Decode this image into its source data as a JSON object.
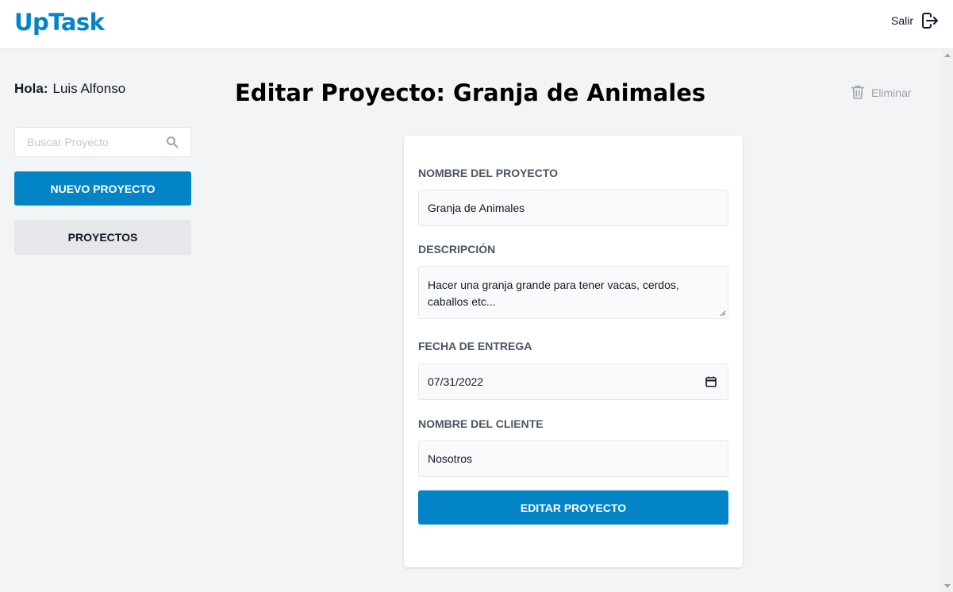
{
  "app": {
    "logo": "UpTask",
    "logout_label": "Salir",
    "brand_color": "#0284c7"
  },
  "sidebar": {
    "greeting_label": "Hola:",
    "user_name": "Luis Alfonso",
    "search_placeholder": "Buscar Proyecto",
    "search_value": "",
    "new_project_label": "NUEVO PROYECTO",
    "projects_label": "PROYECTOS"
  },
  "main": {
    "title": "Editar Proyecto: Granja de Animales",
    "delete_label": "Eliminar"
  },
  "form": {
    "name_label": "NOMBRE DEL PROYECTO",
    "name_value": "Granja de Animales",
    "description_label": "DESCRIPCIÓN",
    "description_value": "Hacer una granja grande para tener vacas, cerdos, caballos etc...",
    "due_date_label": "FECHA DE ENTREGA",
    "due_date_value": "07/31/2022",
    "client_label": "NOMBRE DEL CLIENTE",
    "client_value": "Nosotros",
    "submit_label": "EDITAR PROYECTO"
  },
  "icons": {
    "logout": "logout-icon",
    "search": "search-icon",
    "delete": "trash-icon",
    "calendar": "calendar-icon"
  }
}
